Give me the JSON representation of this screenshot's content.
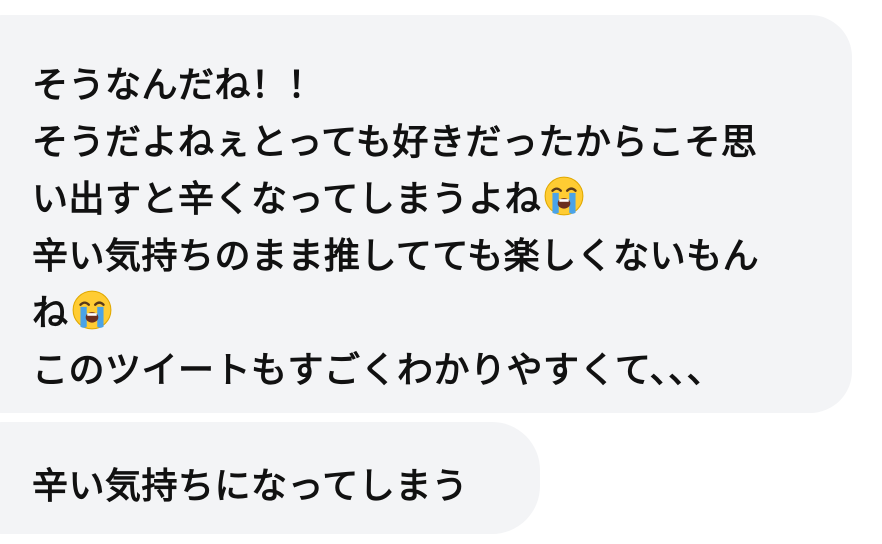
{
  "messages": [
    {
      "lines": [
        {
          "text": "そうなんだね！！"
        },
        {
          "text": "そうだよねぇとっても好きだったからこそ思"
        },
        {
          "text": "い出すと辛くなってしまうよね",
          "emoji": "loudly-crying-face-icon"
        },
        {
          "text": "辛い気持ちのまま推してても楽しくないもん"
        },
        {
          "text": "ね",
          "emoji": "loudly-crying-face-icon"
        },
        {
          "text": "このツイートもすごくわかりやすくて、、、"
        }
      ]
    },
    {
      "lines": [
        {
          "text": "辛い気持ちになってしまう"
        }
      ]
    }
  ],
  "colors": {
    "bubble_background": "#f3f4f6",
    "text": "#111111",
    "emoji_face": "#ffcc33",
    "emoji_tears": "#4aa3e8"
  }
}
